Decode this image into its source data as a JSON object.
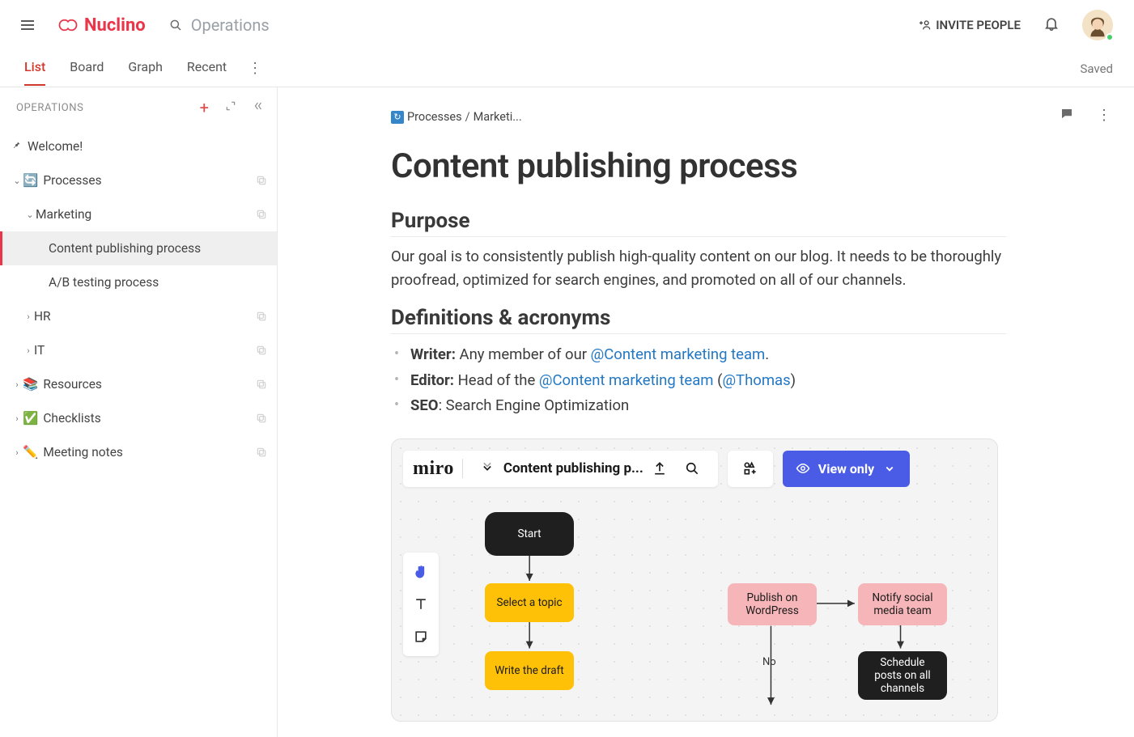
{
  "brand": "Nuclino",
  "search_placeholder": "Operations",
  "header": {
    "invite": "INVITE PEOPLE",
    "saved": "Saved"
  },
  "view_tabs": {
    "t0": "List",
    "t1": "Board",
    "t2": "Graph",
    "t3": "Recent"
  },
  "sidebar": {
    "title": "OPERATIONS",
    "welcome": "Welcome!",
    "processes": "Processes",
    "marketing": "Marketing",
    "content_publishing": "Content publishing process",
    "ab_testing": "A/B testing process",
    "hr": "HR",
    "it": "IT",
    "resources": "Resources",
    "checklists": "Checklists",
    "meeting_notes": "Meeting notes",
    "emoji_processes": "🔄",
    "emoji_resources": "📚",
    "emoji_checklists": "✅",
    "emoji_meeting": "✏️"
  },
  "doc": {
    "crumb1": "Processes",
    "crumb2": "Marketi...",
    "title": "Content publishing process",
    "h_purpose": "Purpose",
    "purpose_text": "Our goal is to consistently publish high-quality content on our blog. It needs to be thoroughly proofread, optimized for search engines, and promoted on all of our channels.",
    "h_defs": "Definitions & acronyms",
    "def_writer_b": "Writer:",
    "def_writer_t": " Any member of our ",
    "def_writer_m": "@Content marketing team",
    "def_writer_end": ".",
    "def_editor_b": "Editor:",
    "def_editor_t": " Head of the ",
    "def_editor_m": "@Content marketing team",
    "def_editor_paren1": " (",
    "def_editor_who": "@Thomas",
    "def_editor_paren2": ")",
    "def_seo_b": "SEO",
    "def_seo_t": ": Search Engine Optimization"
  },
  "embed": {
    "brand": "miro",
    "title": "Content publishing p...",
    "view_only": "View only",
    "nodes": {
      "start": "Start",
      "select_topic": "Select a topic",
      "write_draft": "Write the draft",
      "publish": "Publish on WordPress",
      "notify": "Notify social media team",
      "schedule": "Schedule posts on all channels",
      "no": "No"
    }
  }
}
